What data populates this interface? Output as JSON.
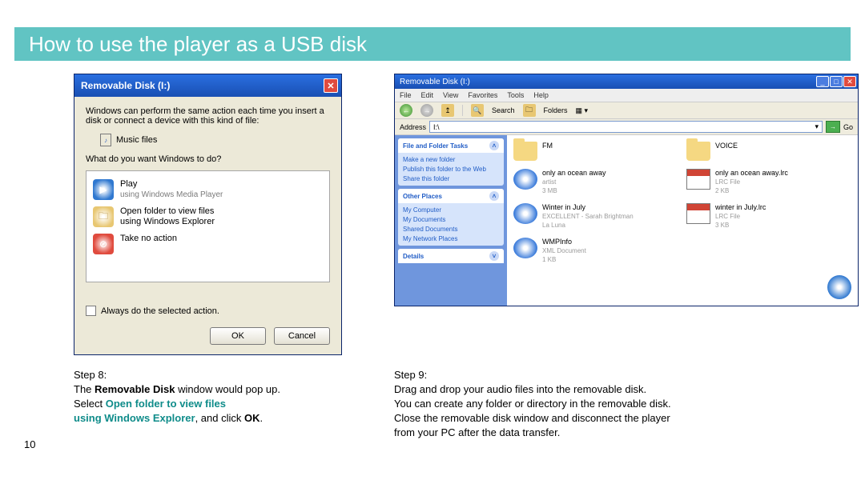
{
  "header": {
    "title": "How to use the player as a USB disk"
  },
  "page_number": "10",
  "dialog": {
    "title": "Removable Disk (I:)",
    "intro": "Windows can perform the same action each time you insert a disk or connect a device with this kind of file:",
    "filetype_label": "Music files",
    "prompt": "What do you want Windows to do?",
    "options": {
      "play": {
        "line1": "Play",
        "line2": "using Windows Media Player"
      },
      "open": {
        "line1": "Open folder to view files",
        "line2": "using Windows Explorer"
      },
      "none": {
        "line1": "Take no action"
      }
    },
    "always_label": "Always do the selected action.",
    "ok_label": "OK",
    "cancel_label": "Cancel"
  },
  "explorer": {
    "title": "Removable Disk (I:)",
    "menus": [
      "File",
      "Edit",
      "View",
      "Favorites",
      "Tools",
      "Help"
    ],
    "toolbar": {
      "search": "Search",
      "folders": "Folders"
    },
    "address_label": "Address",
    "address_value": "I:\\",
    "go_label": "Go",
    "side": {
      "tasks_head": "File and Folder Tasks",
      "tasks": [
        "Make a new folder",
        "Publish this folder to the Web",
        "Share this folder"
      ],
      "places_head": "Other Places",
      "places": [
        "My Computer",
        "My Documents",
        "Shared Documents",
        "My Network Places"
      ],
      "details_head": "Details"
    },
    "files": [
      {
        "name": "FM",
        "sub": "",
        "ico": "folder"
      },
      {
        "name": "VOICE",
        "sub": "",
        "ico": "folder"
      },
      {
        "name": "only an ocean away",
        "sub": "artist\n3 MB",
        "ico": "media"
      },
      {
        "name": "only an ocean away.lrc",
        "sub": "LRC File\n2 KB",
        "ico": "cal"
      },
      {
        "name": "Winter in July",
        "sub": "EXCELLENT - Sarah Brightman\nLa Luna",
        "ico": "media"
      },
      {
        "name": "winter in July.lrc",
        "sub": "LRC File\n3 KB",
        "ico": "cal"
      },
      {
        "name": "WMPInfo",
        "sub": "XML Document\n1 KB",
        "ico": "media"
      }
    ]
  },
  "captions": {
    "step8_label": "Step 8:",
    "step8_l1a": "The ",
    "step8_l1b": "Removable Disk",
    "step8_l1c": " window would pop up.",
    "step8_l2a": "Select ",
    "step8_l2b": "Open folder to view files",
    "step8_l3a": "using Windows Explorer",
    "step8_l3b": ", and click ",
    "step8_l3c": "OK",
    "step8_l3d": ".",
    "step9_label": "Step 9:",
    "step9_l1": "Drag and drop your audio files into the removable disk.",
    "step9_l2": "You can create any folder or directory in the removable disk.",
    "step9_l3": "Close the removable disk window and disconnect the player",
    "step9_l4": "from your PC after the data transfer."
  }
}
